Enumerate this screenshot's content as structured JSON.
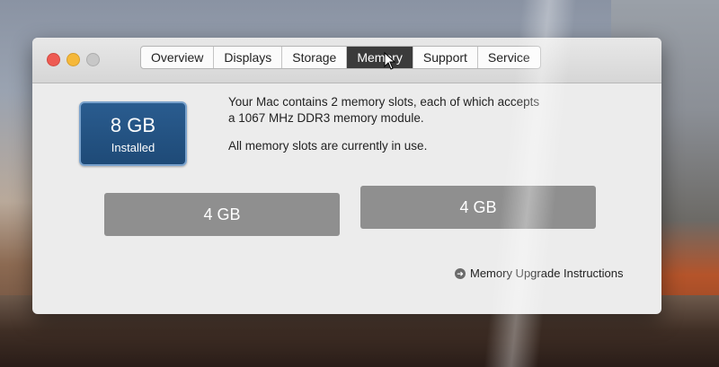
{
  "tabs": [
    {
      "label": "Overview"
    },
    {
      "label": "Displays"
    },
    {
      "label": "Storage"
    },
    {
      "label": "Memory"
    },
    {
      "label": "Support"
    },
    {
      "label": "Service"
    }
  ],
  "active_tab": "Memory",
  "memory": {
    "installed_size": "8 GB",
    "installed_label": "Installed",
    "description_line1": "Your Mac contains 2 memory slots, each of which accepts",
    "description_line2": "a 1067 MHz DDR3 memory module.",
    "status": "All memory slots are currently in use.",
    "slots": [
      {
        "size": "4 GB"
      },
      {
        "size": "4 GB"
      }
    ],
    "upgrade_link": "Memory Upgrade Instructions"
  },
  "colors": {
    "badge_bg": "#1e4a77",
    "active_tab_bg": "#3b3b3b",
    "slot_bg": "#8f8f8f"
  },
  "icons": {
    "close": "close-button",
    "minimize": "minimize-button",
    "zoom": "zoom-button",
    "upgrade": "arrow-circle-icon",
    "cursor": "pointer-cursor-icon"
  }
}
